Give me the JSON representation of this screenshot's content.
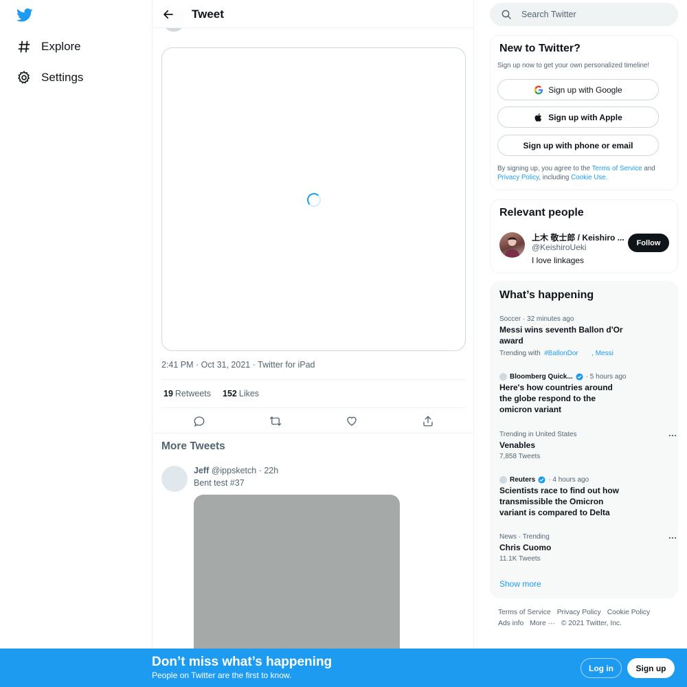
{
  "nav": {
    "logo_icon": "twitter-bird-icon",
    "items": [
      {
        "label": "Explore",
        "icon": "hashtag-icon"
      },
      {
        "label": "Settings",
        "icon": "gear-icon"
      }
    ]
  },
  "header": {
    "title": "Tweet",
    "back_icon": "back-arrow-icon"
  },
  "tweet": {
    "timestamp": "2:41 PM · Oct 31, 2021 · Twitter for iPad",
    "retweets": "19",
    "retweets_label": "Retweets",
    "likes": "152",
    "likes_label": "Likes",
    "actions": [
      "reply-icon",
      "retweet-icon",
      "like-icon",
      "share-icon"
    ]
  },
  "more_tweets": {
    "title": "More Tweets",
    "items": [
      {
        "name": "Jeff",
        "handle": "@ippsketch",
        "time": "· 22h",
        "text": "Bent test #37"
      }
    ]
  },
  "search": {
    "placeholder": "Search Twitter"
  },
  "signup": {
    "title": "New to Twitter?",
    "subtitle": "Sign up now to get your own personalized timeline!",
    "google": "Sign up with Google",
    "apple": "Sign up with Apple",
    "phone": "Sign up with phone or email",
    "terms_prefix": "By signing up, you agree to the",
    "terms_link": "Terms of Service",
    "terms_and": "and",
    "privacy_link": "Privacy Policy",
    "including": ", including",
    "cookie_link": "Cookie Use."
  },
  "relevant_people": {
    "title": "Relevant people",
    "person": {
      "name": "上木 敬士郎 / Keishiro ...",
      "handle": "@KeishiroUeki",
      "bio": "I love linkages"
    },
    "follow_label": "Follow"
  },
  "happening": {
    "title": "What’s happening",
    "trends": [
      {
        "meta_a": "Soccer",
        "meta_b": "32 minutes ago",
        "title": "Messi wins seventh Ballon d'Or award",
        "trending_with": "Trending with",
        "tag1": "#BallonDor",
        "tag2": ", Messi"
      },
      {
        "source": "Bloomberg Quick...",
        "time": "5 hours ago",
        "title": "Here's how countries around the globe respond to the omicron variant"
      },
      {
        "meta": "Trending in United States",
        "title": "Venables",
        "sub": "7,858 Tweets"
      },
      {
        "source": "Reuters",
        "time": "4 hours ago",
        "title": "Scientists race to find out how transmissible the Omicron variant is compared to Delta"
      },
      {
        "meta": "News · Trending",
        "title": "Chris Cuomo",
        "sub": "11.1K Tweets"
      }
    ],
    "show_more": "Show more"
  },
  "footer": {
    "links": [
      "Terms of Service",
      "Privacy Policy",
      "Cookie Policy",
      "Ads info",
      "More ···"
    ],
    "copyright": "© 2021 Twitter, Inc."
  },
  "bottom_bar": {
    "title": "Don’t miss what’s happening",
    "subtitle": "People on Twitter are the first to know.",
    "login": "Log in",
    "signup": "Sign up"
  },
  "colors": {
    "accent": "#1d9bf0",
    "text": "#0f1419",
    "secondary": "#536471"
  }
}
